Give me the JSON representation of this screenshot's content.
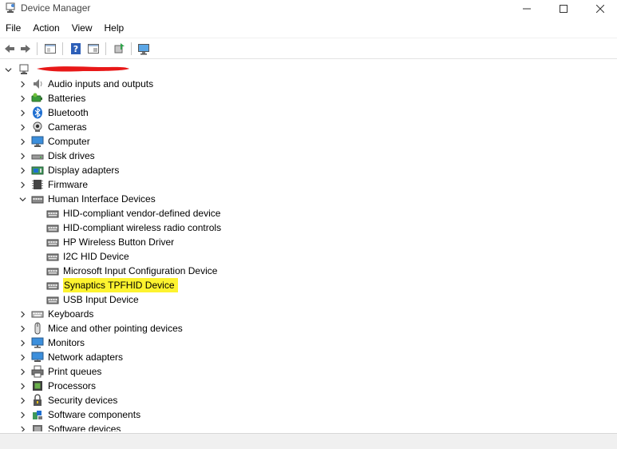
{
  "window": {
    "title": "Device Manager",
    "controls": {
      "minimize": "—",
      "maximize": "☐",
      "close": "✕"
    }
  },
  "menu": [
    "File",
    "Action",
    "View",
    "Help"
  ],
  "toolbar": {
    "buttons": [
      "back-arrow-icon",
      "forward-arrow-icon",
      "properties-icon",
      "help-icon",
      "show-hidden-icon",
      "update-driver-icon",
      "scan-hardware-icon"
    ]
  },
  "tree": {
    "root": {
      "label": "",
      "redacted": true
    },
    "categories": [
      {
        "label": "Audio inputs and outputs",
        "icon": "speaker-icon",
        "expanded": false
      },
      {
        "label": "Batteries",
        "icon": "battery-icon",
        "expanded": false
      },
      {
        "label": "Bluetooth",
        "icon": "bluetooth-icon",
        "expanded": false
      },
      {
        "label": "Cameras",
        "icon": "camera-icon",
        "expanded": false
      },
      {
        "label": "Computer",
        "icon": "computer-icon",
        "expanded": false
      },
      {
        "label": "Disk drives",
        "icon": "disk-drive-icon",
        "expanded": false
      },
      {
        "label": "Display adapters",
        "icon": "display-adapter-icon",
        "expanded": false
      },
      {
        "label": "Firmware",
        "icon": "firmware-icon",
        "expanded": false
      },
      {
        "label": "Human Interface Devices",
        "icon": "hid-icon",
        "expanded": true,
        "children": [
          {
            "label": "HID-compliant vendor-defined device",
            "icon": "hid-device-icon",
            "highlighted": false
          },
          {
            "label": "HID-compliant wireless radio controls",
            "icon": "hid-device-icon",
            "highlighted": false
          },
          {
            "label": "HP Wireless Button Driver",
            "icon": "hid-device-icon",
            "highlighted": false
          },
          {
            "label": "I2C HID Device",
            "icon": "hid-device-icon",
            "highlighted": false
          },
          {
            "label": "Microsoft Input Configuration Device",
            "icon": "hid-device-icon",
            "highlighted": false
          },
          {
            "label": "Synaptics TPFHID Device",
            "icon": "hid-device-icon",
            "highlighted": true
          },
          {
            "label": "USB Input Device",
            "icon": "hid-device-icon",
            "highlighted": false
          }
        ]
      },
      {
        "label": "Keyboards",
        "icon": "keyboard-icon",
        "expanded": false
      },
      {
        "label": "Mice and other pointing devices",
        "icon": "mouse-icon",
        "expanded": false
      },
      {
        "label": "Monitors",
        "icon": "monitor-icon",
        "expanded": false
      },
      {
        "label": "Network adapters",
        "icon": "network-adapter-icon",
        "expanded": false
      },
      {
        "label": "Print queues",
        "icon": "printer-icon",
        "expanded": false
      },
      {
        "label": "Processors",
        "icon": "processor-icon",
        "expanded": false
      },
      {
        "label": "Security devices",
        "icon": "security-device-icon",
        "expanded": false
      },
      {
        "label": "Software components",
        "icon": "software-component-icon",
        "expanded": false
      },
      {
        "label": "Software devices",
        "icon": "software-device-icon",
        "expanded": false
      }
    ]
  },
  "colors": {
    "highlight": "#fdf32f",
    "redaction": "#e81818",
    "icon_blue": "#1f6fd1"
  }
}
